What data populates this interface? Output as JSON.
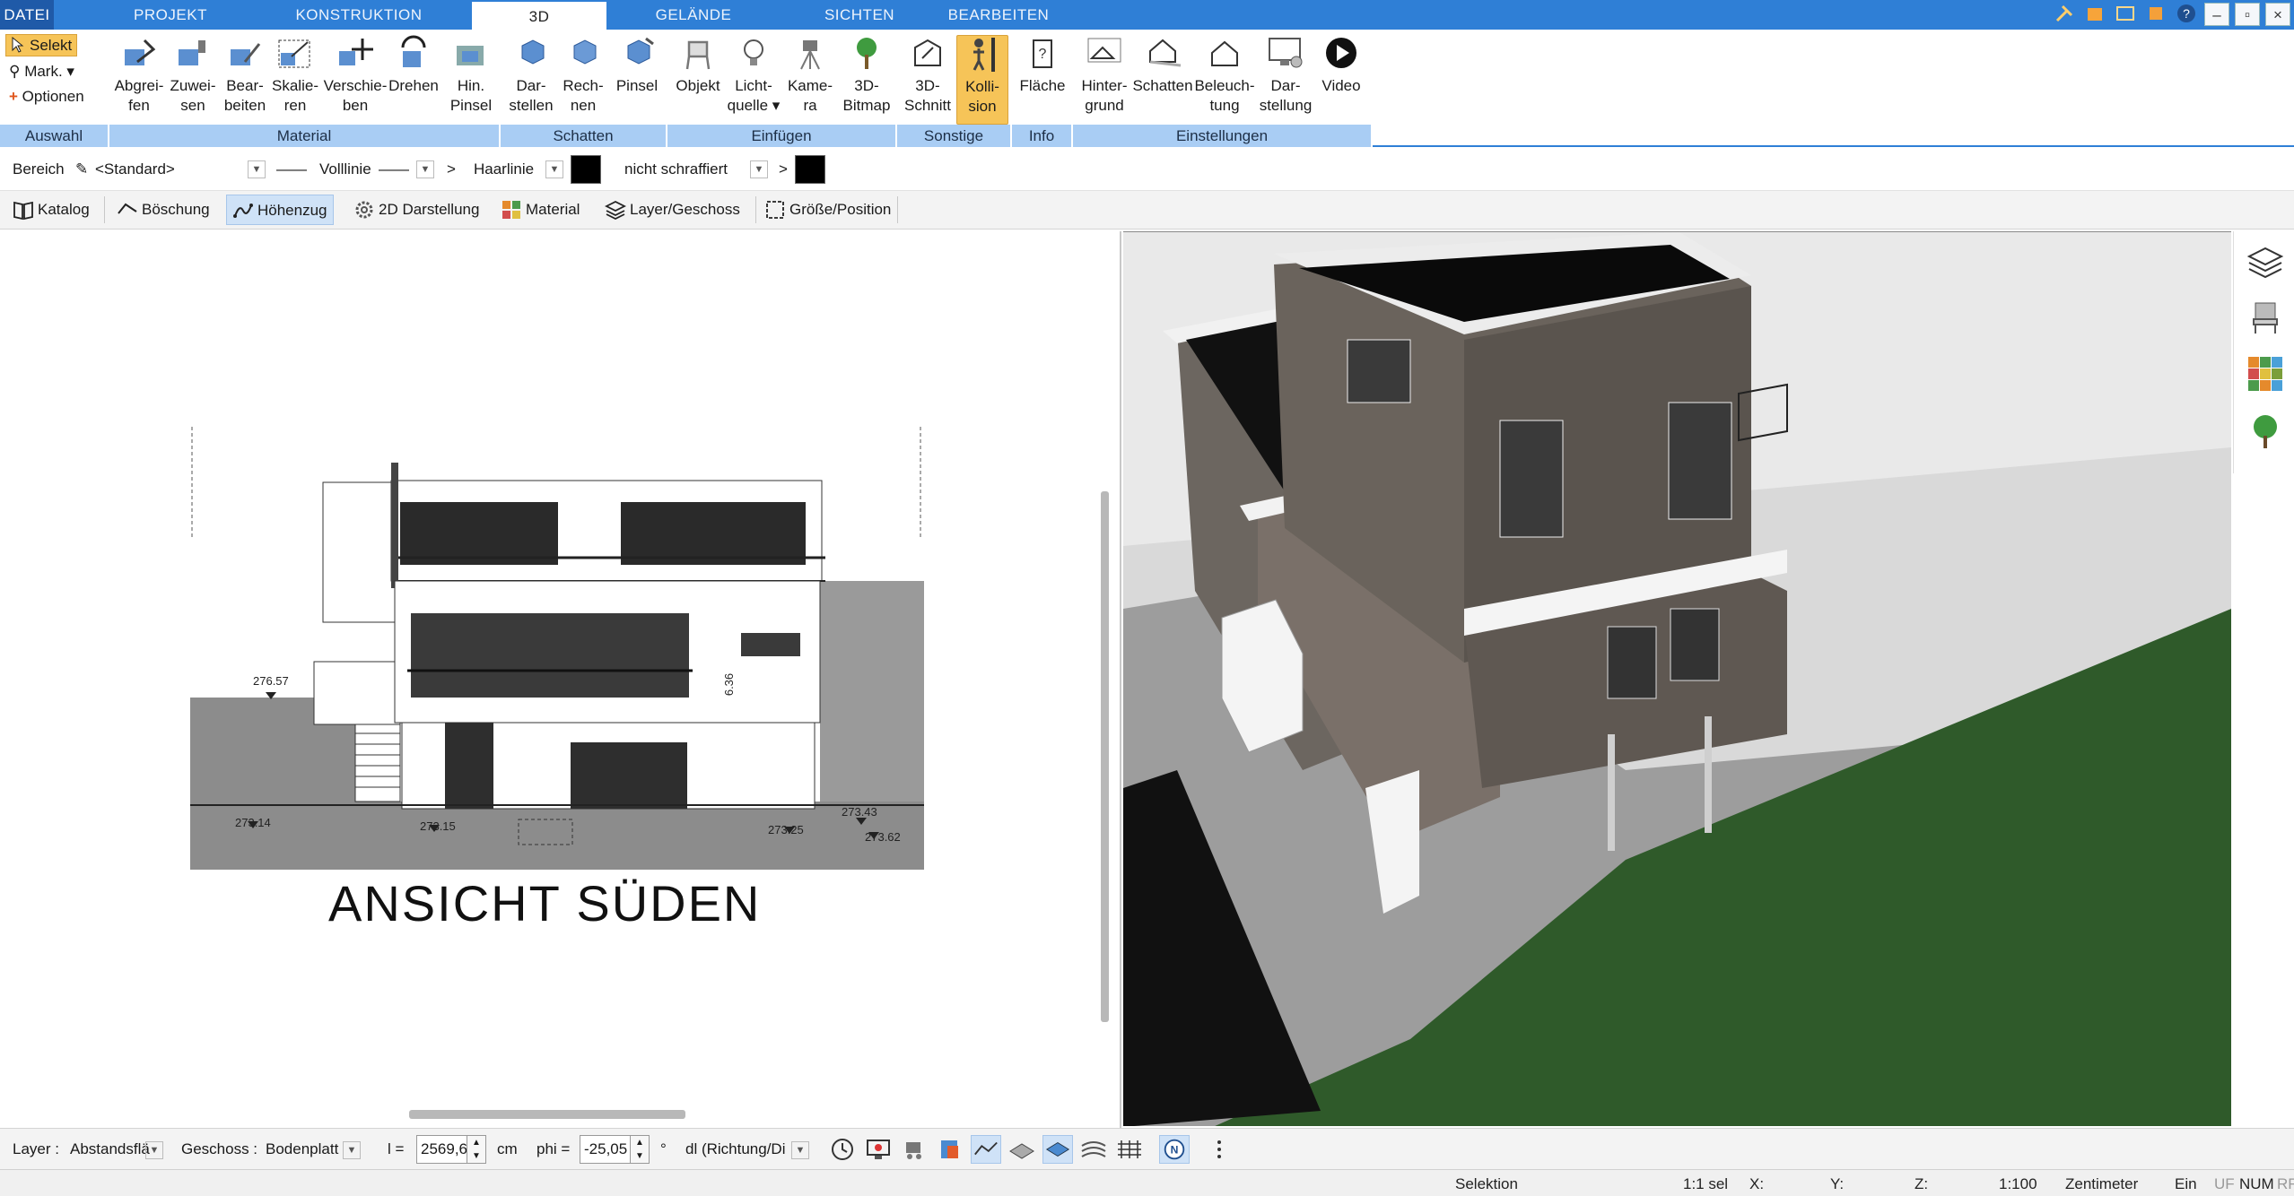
{
  "tabs": [
    {
      "label": "DATEI"
    },
    {
      "label": "PROJEKT"
    },
    {
      "label": "KONSTRUKTION"
    },
    {
      "label": "3D"
    },
    {
      "label": "GELÄNDE"
    },
    {
      "label": "SICHTEN"
    },
    {
      "label": "BEARBEITEN"
    }
  ],
  "ribbon": {
    "auswahl": {
      "label": "Auswahl",
      "selekt": "Selekt",
      "mark": "Mark.",
      "optionen": "Optionen"
    },
    "material": {
      "label": "Material",
      "buttons": [
        {
          "l1": "Abgrei-",
          "l2": "fen"
        },
        {
          "l1": "Zuwei-",
          "l2": "sen"
        },
        {
          "l1": "Bear-",
          "l2": "beiten"
        },
        {
          "l1": "Skalie-",
          "l2": "ren"
        },
        {
          "l1": "Verschie-",
          "l2": "ben"
        },
        {
          "l1": "Drehen",
          "l2": ""
        },
        {
          "l1": "Hin.",
          "l2": "Pinsel"
        }
      ]
    },
    "schatten": {
      "label": "Schatten",
      "buttons": [
        {
          "l1": "Dar-",
          "l2": "stellen"
        },
        {
          "l1": "Rech-",
          "l2": "nen"
        },
        {
          "l1": "Pinsel",
          "l2": ""
        }
      ]
    },
    "einfuegen": {
      "label": "Einfügen",
      "buttons": [
        {
          "l1": "Objekt",
          "l2": ""
        },
        {
          "l1": "Licht-",
          "l2": "quelle"
        },
        {
          "l1": "Kame-",
          "l2": "ra"
        },
        {
          "l1": "3D-",
          "l2": "Bitmap"
        }
      ]
    },
    "sonstige": {
      "label": "Sonstige",
      "buttons": [
        {
          "l1": "3D-",
          "l2": "Schnitt"
        },
        {
          "l1": "Kolli-",
          "l2": "sion"
        }
      ]
    },
    "info": {
      "label": "Info",
      "buttons": [
        {
          "l1": "Fläche",
          "l2": ""
        }
      ]
    },
    "einstellungen": {
      "label": "Einstellungen",
      "buttons": [
        {
          "l1": "Hinter-",
          "l2": "grund"
        },
        {
          "l1": "Schatten",
          "l2": ""
        },
        {
          "l1": "Beleuch-",
          "l2": "tung"
        },
        {
          "l1": "Dar-",
          "l2": "stellung"
        },
        {
          "l1": "Video",
          "l2": ""
        }
      ]
    }
  },
  "props": {
    "bereich": "Bereich",
    "standard": "<Standard>",
    "linetype": "Volllinie",
    "linewidth": "Haarlinie",
    "hatch": "nicht schraffiert",
    "gt1": ">",
    "gt2": ">"
  },
  "toolbar": {
    "katalog": "Katalog",
    "boeschung": "Böschung",
    "hoehenzug": "Höhenzug",
    "darstellung2d": "2D Darstellung",
    "material": "Material",
    "layer": "Layer/Geschoss",
    "groesse": "Größe/Position"
  },
  "plan": {
    "title": "ANSICHT SÜDEN",
    "elevations": [
      "276.57",
      "273.14",
      "273.15",
      "273.25",
      "273.43",
      "273.62",
      "6.36"
    ]
  },
  "inputs": {
    "layer_label": "Layer :",
    "layer_value": "Abstandsflä",
    "geschoss_label": "Geschoss :",
    "geschoss_value": "Bodenplatt",
    "l_label": "l =",
    "l_value": "2569,6",
    "l_unit": "cm",
    "phi_label": "phi =",
    "phi_value": "-25,05",
    "phi_unit": "°",
    "dl_value": "dl (Richtung/Di"
  },
  "status": {
    "mode": "Selektion",
    "sel": "1:1 sel",
    "x": "X:",
    "y": "Y:",
    "z": "Z:",
    "scale": "1:100",
    "unit": "Zentimeter",
    "ein": "Ein",
    "uf": "UF",
    "num": "NUM",
    "rf": "RF"
  }
}
